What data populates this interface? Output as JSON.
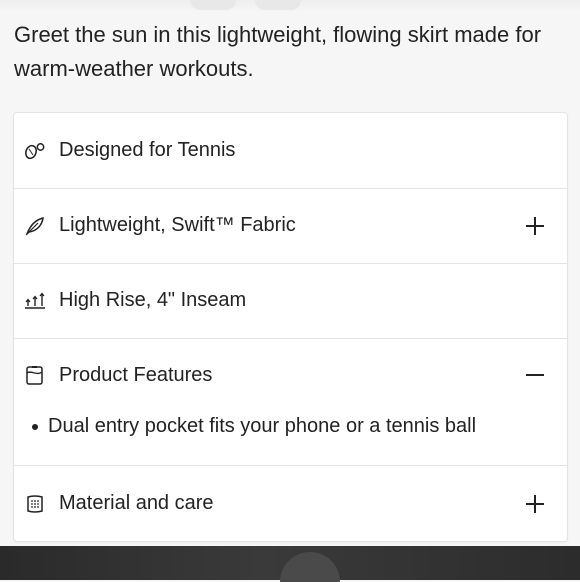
{
  "description": "Greet the sun in this lightweight, flowing skirt made for warm-weather workouts.",
  "accordion": [
    {
      "label": "Designed for Tennis",
      "icon": "tennis-icon",
      "toggle": ""
    },
    {
      "label": "Lightweight, Swift™ Fabric",
      "icon": "feather-icon",
      "toggle": "plus"
    },
    {
      "label": "High Rise, 4\" Inseam",
      "icon": "rise-inseam-icon",
      "toggle": ""
    },
    {
      "label": "Product Features",
      "icon": "product-features-icon",
      "toggle": "minus"
    },
    {
      "label": "Material and care",
      "icon": "fabric-care-icon",
      "toggle": "plus"
    }
  ],
  "product_features": {
    "bullets": [
      "Dual entry pocket fits your phone or a tennis ball"
    ]
  }
}
